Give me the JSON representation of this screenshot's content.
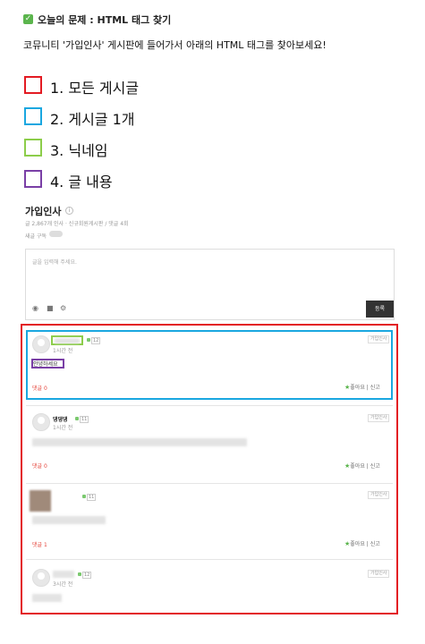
{
  "question": {
    "title": "오늘의 문제 : HTML 태그 찾기",
    "description": "코뮤니티 '가입인사' 게시판에 들어가서 아래의 HTML 태그를 찾아보세요!"
  },
  "legend": [
    {
      "label": "1. 모든 게시글",
      "color": "#e31b23"
    },
    {
      "label": "2. 게시글 1개",
      "color": "#1aa7e0"
    },
    {
      "label": "3. 닉네임",
      "color": "#8ccd4a"
    },
    {
      "label": "4. 글 내용",
      "color": "#7a3fa6"
    }
  ],
  "board": {
    "title": "가입인사",
    "meta": "글 2,867개 인사 · 신규회원게시판 / 댓글 4회",
    "subscribe_label": "새글 구독",
    "editor_placeholder": "글을 입력해 주세요.",
    "submit_label": "등록"
  },
  "posts": [
    {
      "nickname": "",
      "time": "1시간 전",
      "content": "안녕하세요",
      "comments": "댓글 0",
      "like": "좋아요",
      "report": "신고",
      "tag": "가입인사"
    },
    {
      "nickname": "댕댕댕",
      "time": "1시간 전",
      "content": "",
      "comments": "댓글 0",
      "like": "좋아요",
      "report": "신고",
      "tag": "가입인사"
    },
    {
      "nickname": "",
      "time": "",
      "content": "",
      "comments": "댓글 1",
      "like": "좋아요",
      "report": "신고",
      "tag": "가입인사"
    },
    {
      "nickname": "",
      "time": "3시간 전",
      "content": "",
      "comments": "",
      "like": "",
      "report": "",
      "tag": "가입인사"
    }
  ],
  "icons": {
    "check": "check-icon",
    "camera": "camera-icon",
    "video": "video-icon",
    "settings": "gear-icon"
  }
}
